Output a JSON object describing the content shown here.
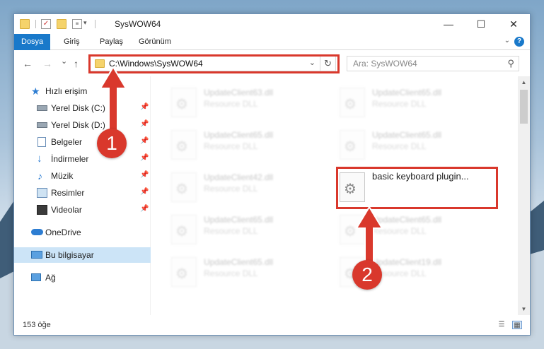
{
  "window": {
    "title": "SysWOW64",
    "controls": {
      "minimize": "—",
      "maximize": "☐",
      "close": "✕"
    }
  },
  "ribbon": {
    "tabs": [
      {
        "label": "Dosya",
        "active": true
      },
      {
        "label": "Giriş"
      },
      {
        "label": "Paylaş"
      },
      {
        "label": "Görünüm"
      }
    ],
    "help": "?"
  },
  "navigation": {
    "back": "←",
    "forward": "→",
    "recent": "⌄",
    "up": "↑",
    "address": "C:\\Windows\\SysWOW64",
    "search_placeholder": "Ara: SysWOW64"
  },
  "sidebar": {
    "items": [
      {
        "label": "Hızlı erişim",
        "icon": "star-icon"
      },
      {
        "label": "Yerel Disk (C:)",
        "icon": "drive-icon",
        "pinned": true
      },
      {
        "label": "Yerel Disk (D:)",
        "icon": "drive-icon",
        "pinned": true
      },
      {
        "label": "Belgeler",
        "icon": "documents-icon",
        "pinned": true
      },
      {
        "label": "İndirmeler",
        "icon": "downloads-icon",
        "pinned": true
      },
      {
        "label": "Müzik",
        "icon": "music-icon",
        "pinned": true
      },
      {
        "label": "Resimler",
        "icon": "pictures-icon",
        "pinned": true
      },
      {
        "label": "Videolar",
        "icon": "videos-icon",
        "pinned": true
      },
      {
        "label": "OneDrive",
        "icon": "cloud-icon"
      },
      {
        "label": "Bu bilgisayar",
        "icon": "computer-icon",
        "selected": true
      },
      {
        "label": "Ağ",
        "icon": "network-icon"
      }
    ]
  },
  "files": [
    {
      "name": "UpdateClient63.dll",
      "type": "Resource DLL"
    },
    {
      "name": "UpdateClient65.dll",
      "type": "Resource DLL"
    },
    {
      "name": "UpdateClient65.dll",
      "type": "Resource DLL"
    },
    {
      "name": "UpdateClient65.dll",
      "type": "Resource DLL"
    },
    {
      "name": "UpdateClient42.dll",
      "type": "Resource DLL"
    },
    {
      "name": "basic keyboard plugin...",
      "type": ""
    },
    {
      "name": "UpdateClient65.dll",
      "type": "Resource DLL"
    },
    {
      "name": "UpdateClient65.dll",
      "type": "Resource DLL"
    },
    {
      "name": "UpdateClient65.dll",
      "type": "Resource DLL"
    },
    {
      "name": "UpdateClient19.dll",
      "type": "Resource DLL"
    }
  ],
  "status": {
    "item_count": "153 öğe"
  },
  "callouts": {
    "first": "1",
    "second": "2"
  },
  "colors": {
    "accent": "#1979ca",
    "highlight": "#d9382c",
    "selected": "#cce4f7"
  }
}
